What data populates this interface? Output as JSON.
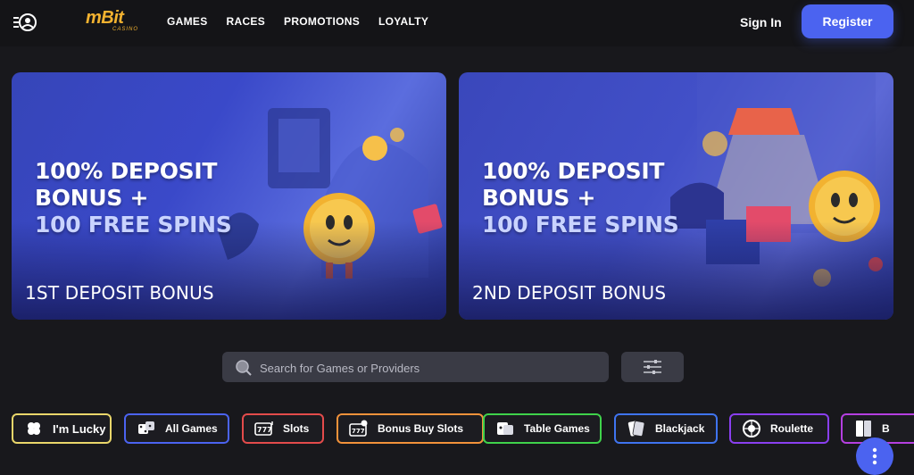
{
  "header": {
    "logo_text": "mBit",
    "logo_sub": "CASINO",
    "nav": [
      "GAMES",
      "RACES",
      "PROMOTIONS",
      "LOYALTY"
    ],
    "sign_in": "Sign In",
    "register": "Register"
  },
  "banners": [
    {
      "headline_1": "100% DEPOSIT",
      "headline_2": "BONUS +",
      "headline_3": "100 FREE SPINS",
      "title": "1ST DEPOSIT BONUS"
    },
    {
      "headline_1": "100% DEPOSIT",
      "headline_2": "BONUS +",
      "headline_3": "100 FREE SPINS",
      "title": "2ND DEPOSIT BONUS"
    }
  ],
  "search": {
    "placeholder": "Search for Games or Providers"
  },
  "categories": [
    {
      "label": "I'm Lucky",
      "icon": "clover-icon",
      "color": "#e9d66a"
    },
    {
      "label": "All Games",
      "icon": "dice-icon",
      "color": "#4b63f0"
    },
    {
      "label": "Slots",
      "icon": "slot-777-icon",
      "color": "#e34b4b"
    },
    {
      "label": "Bonus Buy Slots",
      "icon": "bonus-slot-icon",
      "color": "#f2923a"
    },
    {
      "label": "Table Games",
      "icon": "table-games-icon",
      "color": "#3fd24b"
    },
    {
      "label": "Blackjack",
      "icon": "cards-icon",
      "color": "#3f74f0"
    },
    {
      "label": "Roulette",
      "icon": "roulette-icon",
      "color": "#8a3ff0"
    },
    {
      "label": "B",
      "icon": "baccarat-icon",
      "color": "#b53fe0"
    }
  ],
  "colors": {
    "accent": "#4b63f0",
    "background": "#18181c",
    "logo": "#f2b230"
  }
}
